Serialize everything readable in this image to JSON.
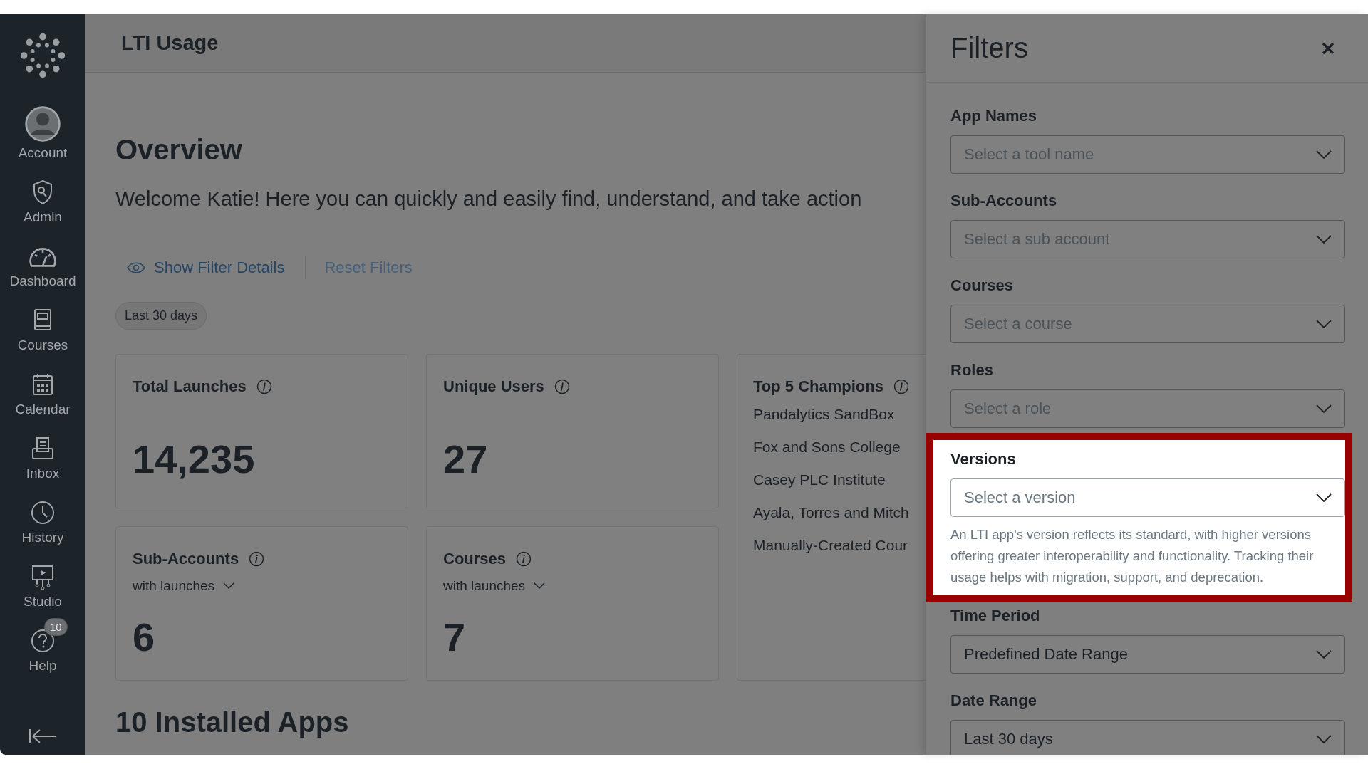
{
  "nav": {
    "items": [
      {
        "label": "Account"
      },
      {
        "label": "Admin"
      },
      {
        "label": "Dashboard"
      },
      {
        "label": "Courses"
      },
      {
        "label": "Calendar"
      },
      {
        "label": "Inbox"
      },
      {
        "label": "History"
      },
      {
        "label": "Studio"
      },
      {
        "label": "Help",
        "badge": "10"
      }
    ]
  },
  "header": {
    "title": "LTI Usage"
  },
  "overview": {
    "title": "Overview",
    "welcome": "Welcome Katie! Here you can quickly and easily find, understand, and take action",
    "show_filter_details": "Show Filter Details",
    "reset_filters": "Reset Filters",
    "filter_chip": "Last 30 days"
  },
  "cards": [
    {
      "kind": "stat",
      "title": "Total Launches",
      "value": "14,235"
    },
    {
      "kind": "stat",
      "title": "Unique Users",
      "value": "27"
    },
    {
      "kind": "list",
      "title": "Top 5 Champions",
      "items": [
        "Pandalytics SandBox",
        "Fox and Sons College",
        "Casey PLC Institute",
        "Ayala, Torres and Mitch",
        "Manually-Created Cour"
      ]
    },
    {
      "kind": "stat",
      "title": "Sub-Accounts",
      "subtitle": "with launches",
      "value": "6"
    },
    {
      "kind": "stat",
      "title": "Courses",
      "subtitle": "with launches",
      "value": "7"
    }
  ],
  "installed_apps_heading": "10 Installed Apps",
  "filters_panel": {
    "title": "Filters",
    "filters": [
      {
        "label": "App Names",
        "placeholder": "Select a tool name",
        "highlighted": false
      },
      {
        "label": "Sub-Accounts",
        "placeholder": "Select a sub account",
        "highlighted": false
      },
      {
        "label": "Courses",
        "placeholder": "Select a course",
        "highlighted": false
      },
      {
        "label": "Roles",
        "placeholder": "Select a role",
        "highlighted": false
      },
      {
        "label": "Versions",
        "placeholder": "Select a version",
        "highlighted": true,
        "description": "An LTI app's version reflects its standard, with higher versions offering greater interoperability and functionality. Tracking their usage helps with migration, support, and deprecation."
      },
      {
        "label": "Time Period",
        "value": "Predefined Date Range",
        "highlighted": false
      },
      {
        "label": "Date Range",
        "value": "Last 30 days",
        "highlighted": false
      }
    ]
  }
}
